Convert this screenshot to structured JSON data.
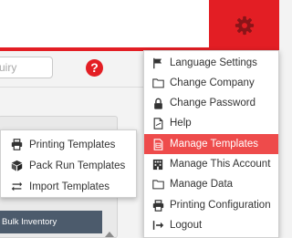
{
  "search": {
    "placeholder": "uiry"
  },
  "help": {
    "label": "?"
  },
  "bulk_tab": {
    "label": "Bulk Inventory"
  },
  "submenu": {
    "items": [
      {
        "label": "Printing Templates",
        "icon": "printer-icon"
      },
      {
        "label": "Pack Run Templates",
        "icon": "cube-icon"
      },
      {
        "label": "Import Templates",
        "icon": "exchange-icon"
      }
    ]
  },
  "dropdown": {
    "items": [
      {
        "label": "Language Settings",
        "icon": "flag-icon"
      },
      {
        "label": "Change Company",
        "icon": "folder-icon"
      },
      {
        "label": "Change Password",
        "icon": "lock-icon"
      },
      {
        "label": "Help",
        "icon": "document-icon"
      },
      {
        "label": "Manage Templates",
        "icon": "template-icon",
        "active": true
      },
      {
        "label": "Manage This Account",
        "icon": "building-icon"
      },
      {
        "label": "Manage Data",
        "icon": "folder-icon"
      },
      {
        "label": "Printing Configuration",
        "icon": "printer-icon"
      },
      {
        "label": "Logout",
        "icon": "logout-icon"
      }
    ]
  },
  "colors": {
    "brand_red": "#e31e24",
    "active_item": "#ee4b4b",
    "bulk_tab_bg": "#4c5b6c"
  }
}
